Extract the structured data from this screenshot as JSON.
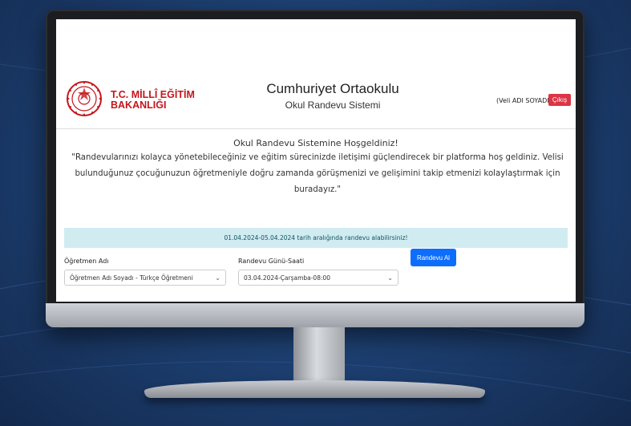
{
  "header": {
    "logo_line1": "T.C. MİLLÎ EĞİTİM",
    "logo_line2": "BAKANLIĞI",
    "school_name": "Cumhuriyet Ortaokulu",
    "system_name": "Okul Randevu Sistemi",
    "user_name": "(Veli ADI SOYADI)",
    "logout_label": "Çıkış"
  },
  "welcome": {
    "title": "Okul Randevu Sistemine Hoşgeldiniz!",
    "text": "\"Randevularınızı kolayca yönetebileceğiniz ve eğitim sürecinizde iletişimi güçlendirecek bir platforma hoş geldiniz. Velisi bulunduğunuz çocuğunuzun öğretmeniyle doğru zamanda görüşmenizi ve gelişimini takip etmenizi kolaylaştırmak için buradayız.\""
  },
  "alert": {
    "text": "01.04.2024-05.04.2024 tarih aralığında randevu alabilirsiniz!"
  },
  "form": {
    "teacher_label": "Öğretmen Adı",
    "teacher_value": "Öğretmen Adı Soyadı - Türkçe Öğretmeni",
    "date_label": "Randevu Günü-Saati",
    "date_value": "03.04.2024-Çarşamba-08:00",
    "submit_label": "Randevu Al"
  },
  "colors": {
    "brand_red": "#c4161c",
    "logout_red": "#dc3545",
    "primary_blue": "#0d6efd",
    "alert_bg": "#d1ecf1"
  },
  "icons": [
    "meb-emblem-icon",
    "chevron-down-icon"
  ]
}
